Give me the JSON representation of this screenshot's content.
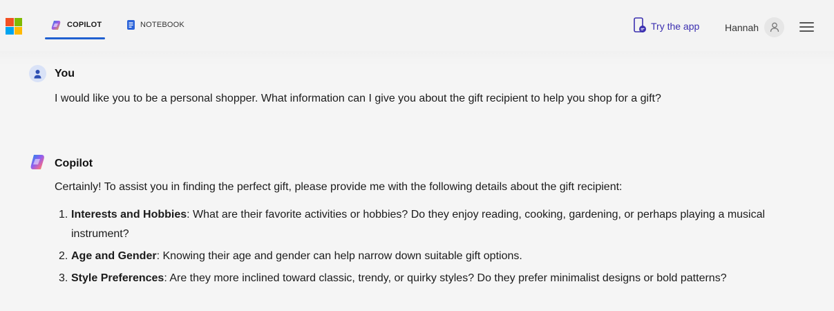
{
  "header": {
    "tabs": [
      {
        "label": "COPILOT",
        "active": true
      },
      {
        "label": "NOTEBOOK",
        "active": false
      }
    ],
    "try_app_label": "Try the app",
    "user_name": "Hannah",
    "accent_color": "#1f5fd0",
    "link_color": "#3b2fb0"
  },
  "conversation": {
    "user_message": {
      "author": "You",
      "text": "I would like you to be a personal shopper. What information can I give you about the gift recipient to help you shop for a gift?"
    },
    "copilot_message": {
      "author": "Copilot",
      "intro": "Certainly! To assist you in finding the perfect gift, please provide me with the following details about the gift recipient:",
      "items": [
        {
          "num": "1.",
          "title": "Interests and Hobbies",
          "text": ": What are their favorite activities or hobbies? Do they enjoy reading, cooking, gardening, or perhaps playing a musical instrument?"
        },
        {
          "num": "2.",
          "title": "Age and Gender",
          "text": ": Knowing their age and gender can help narrow down suitable gift options."
        },
        {
          "num": "3.",
          "title": "Style Preferences",
          "text": ": Are they more inclined toward classic, trendy, or quirky styles? Do they prefer minimalist designs or bold patterns?"
        }
      ]
    }
  }
}
